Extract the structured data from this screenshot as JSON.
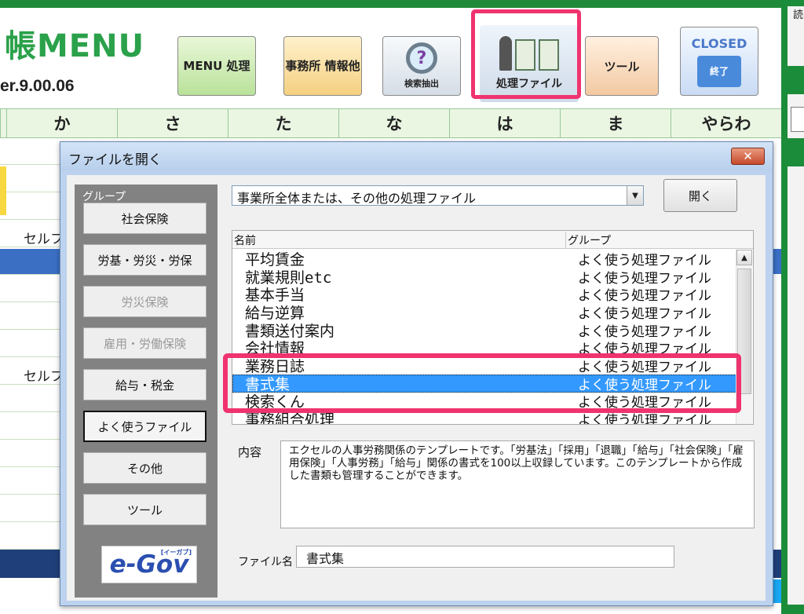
{
  "app": {
    "title": "帳MENU",
    "version": "er.9.00.06"
  },
  "toolbar": {
    "menu": "MENU 処理",
    "office": "事務所 情報他",
    "search": "検索抽出",
    "search_glyph": "?",
    "file": "処理ファイル",
    "tool": "ツール",
    "closed": "CLOSED",
    "exit": "終了"
  },
  "kana_tabs": [
    "か",
    "さ",
    "た",
    "な",
    "は",
    "ま",
    "やらわ"
  ],
  "background_rows": [
    "セルフ",
    "セルフ"
  ],
  "right_char": "読",
  "dialog": {
    "title": "ファイルを開く",
    "close_glyph": "✕",
    "group_label": "グループ",
    "groups": [
      {
        "label": "社会保険",
        "state": "normal"
      },
      {
        "label": "労基・労災・労保",
        "state": "normal"
      },
      {
        "label": "労災保険",
        "state": "disabled"
      },
      {
        "label": "雇用・労働保険",
        "state": "disabled"
      },
      {
        "label": "給与・税金",
        "state": "normal"
      },
      {
        "label": "よく使うファイル",
        "state": "selected"
      },
      {
        "label": "その他",
        "state": "normal"
      },
      {
        "label": "ツール",
        "state": "normal"
      }
    ],
    "egov": {
      "main": "e-Gov",
      "small": "[イーガブ]"
    },
    "combo_value": "事業所全体または、その他の処理ファイル",
    "combo_arrow": "▼",
    "open_button": "開く",
    "columns": {
      "name": "名前",
      "group": "グループ"
    },
    "scroll_up": "▲",
    "files": [
      {
        "name": "平均賃金",
        "group": "よく使う処理ファイル"
      },
      {
        "name": "就業規則etc",
        "group": "よく使う処理ファイル"
      },
      {
        "name": "基本手当",
        "group": "よく使う処理ファイル"
      },
      {
        "name": "給与逆算",
        "group": "よく使う処理ファイル"
      },
      {
        "name": "書類送付案内",
        "group": "よく使う処理ファイル"
      },
      {
        "name": "会社情報",
        "group": "よく使う処理ファイル"
      },
      {
        "name": "業務日誌",
        "group": "よく使う処理ファイル"
      },
      {
        "name": "書式集",
        "group": "よく使う処理ファイル"
      },
      {
        "name": "検索くん",
        "group": "よく使う処理ファイル"
      },
      {
        "name": "事務組合処理",
        "group": "よく使う処理ファイル"
      }
    ],
    "selected_index": 7,
    "description_label": "内容",
    "description": "エクセルの人事労務関係のテンプレートです。「労基法」「採用」「退職」「給与」「社会保険」「雇用保険」「人事労務」「給与」関係の書式を100以上収録しています。このテンプレートから作成した書類も管理することができます。",
    "filename_label": "ファイル名",
    "filename_value": "書式集"
  },
  "colors": {
    "brand_green": "#2aa14a",
    "highlight": "#f0336f",
    "selection": "#3399ff"
  }
}
